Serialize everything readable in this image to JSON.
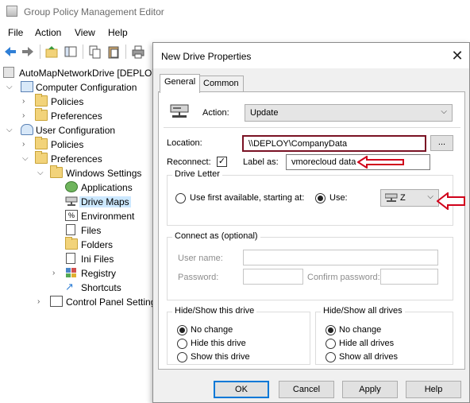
{
  "window": {
    "title": "Group Policy Management Editor"
  },
  "menu": [
    "File",
    "Action",
    "View",
    "Help"
  ],
  "toolbar": {
    "icons": [
      "back-arrow-icon",
      "forward-arrow-icon",
      "folder-up-icon",
      "show-hide-tree-icon",
      "copy-icon",
      "paste-icon",
      "print-icon"
    ]
  },
  "tree": {
    "root": "AutoMapNetworkDrive [DEPLOY",
    "computer_configuration": "Computer Configuration",
    "cc_policies": "Policies",
    "cc_preferences": "Preferences",
    "user_configuration": "User Configuration",
    "uc_policies": "Policies",
    "uc_preferences": "Preferences",
    "windows_settings": "Windows Settings",
    "applications": "Applications",
    "drive_maps": "Drive Maps",
    "environment": "Environment",
    "files": "Files",
    "folders": "Folders",
    "ini_files": "Ini Files",
    "registry": "Registry",
    "shortcuts": "Shortcuts",
    "control_panel_settings": "Control Panel Setting"
  },
  "dialog": {
    "title": "New Drive Properties",
    "tabs": [
      "General",
      "Common"
    ],
    "action_label": "Action:",
    "action_value": "Update",
    "location_label": "Location:",
    "location_value": "\\\\DEPLOY\\CompanyData",
    "browse_label": "...",
    "reconnect_label": "Reconnect:",
    "reconnect_checked": "✓",
    "label_as_label": "Label as:",
    "label_as_value": "vmorecloud data",
    "drive_letter_group": "Drive Letter",
    "use_first_available": "Use first available, starting at:",
    "use_label": "Use:",
    "drive_value": "Z",
    "connect_as_group": "Connect as (optional)",
    "user_name_label": "User name:",
    "password_label": "Password:",
    "confirm_password_label": "Confirm password:",
    "hide_show_drive_group": "Hide/Show this drive",
    "drive_options": [
      "No change",
      "Hide this drive",
      "Show this drive"
    ],
    "hide_show_all_group": "Hide/Show all drives",
    "all_options": [
      "No change",
      "Hide all drives",
      "Show all drives"
    ],
    "buttons": {
      "ok": "OK",
      "cancel": "Cancel",
      "apply": "Apply",
      "help": "Help"
    },
    "highlight_color": "#7a1224",
    "arrow_color": "#d0021b"
  }
}
